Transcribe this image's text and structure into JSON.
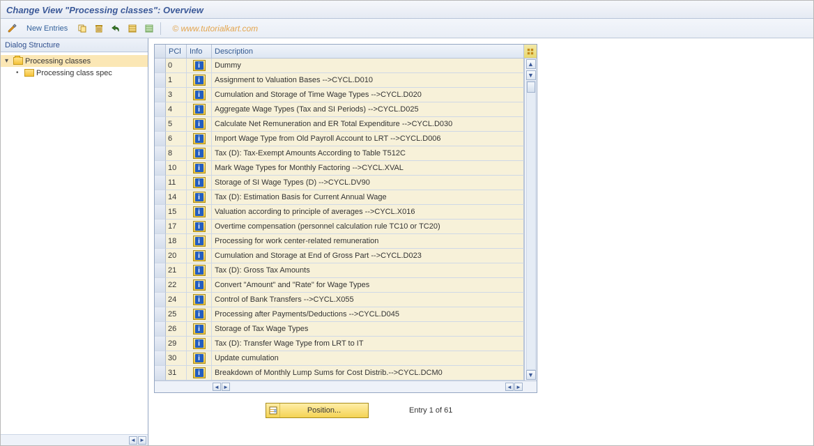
{
  "title": "Change View \"Processing classes\": Overview",
  "watermark": "© www.tutorialkart.com",
  "toolbar": {
    "new_entries_label": "New Entries"
  },
  "sidebar": {
    "header": "Dialog Structure",
    "nodes": [
      {
        "label": "Processing classes",
        "level": 1,
        "selected": true,
        "open": true
      },
      {
        "label": "Processing class spec",
        "level": 2,
        "selected": false,
        "open": false
      }
    ]
  },
  "grid": {
    "columns": {
      "pci": "PCl",
      "info": "Info",
      "description": "Description"
    },
    "rows": [
      {
        "pci": "0",
        "desc": "Dummy"
      },
      {
        "pci": "1",
        "desc": "Assignment to Valuation Bases -->CYCL.D010"
      },
      {
        "pci": "3",
        "desc": "Cumulation and Storage of Time Wage Types -->CYCL.D020"
      },
      {
        "pci": "4",
        "desc": "Aggregate Wage Types (Tax and SI Periods) -->CYCL.D025"
      },
      {
        "pci": "5",
        "desc": "Calculate Net Remuneration and ER Total Expenditure -->CYCL.D030"
      },
      {
        "pci": "6",
        "desc": "Import Wage Type from Old Payroll Account to LRT -->CYCL.D006"
      },
      {
        "pci": "8",
        "desc": "Tax (D): Tax-Exempt Amounts According to Table T512C"
      },
      {
        "pci": "10",
        "desc": "Mark Wage Types for Monthly Factoring -->CYCL.XVAL"
      },
      {
        "pci": "11",
        "desc": "Storage of SI Wage Types (D) -->CYCL.DV90"
      },
      {
        "pci": "14",
        "desc": "Tax (D): Estimation Basis for Current Annual Wage"
      },
      {
        "pci": "15",
        "desc": "Valuation according to principle of averages -->CYCL.X016"
      },
      {
        "pci": "17",
        "desc": "Overtime compensation (personnel calculation rule TC10 or TC20)"
      },
      {
        "pci": "18",
        "desc": "Processing for work center-related remuneration"
      },
      {
        "pci": "20",
        "desc": "Cumulation and Storage at End of Gross Part -->CYCL.D023"
      },
      {
        "pci": "21",
        "desc": "Tax (D): Gross Tax Amounts"
      },
      {
        "pci": "22",
        "desc": "Convert \"Amount\" and \"Rate\" for Wage Types"
      },
      {
        "pci": "24",
        "desc": "Control of Bank Transfers -->CYCL.X055"
      },
      {
        "pci": "25",
        "desc": "Processing after Payments/Deductions -->CYCL.D045"
      },
      {
        "pci": "26",
        "desc": "Storage of Tax Wage Types"
      },
      {
        "pci": "29",
        "desc": "Tax (D): Transfer Wage Type from LRT to IT"
      },
      {
        "pci": "30",
        "desc": "Update cumulation"
      },
      {
        "pci": "31",
        "desc": "Breakdown of Monthly Lump Sums for Cost Distrib.-->CYCL.DCM0"
      }
    ]
  },
  "footer": {
    "position_label": "Position...",
    "entry_text": "Entry 1 of 61"
  }
}
